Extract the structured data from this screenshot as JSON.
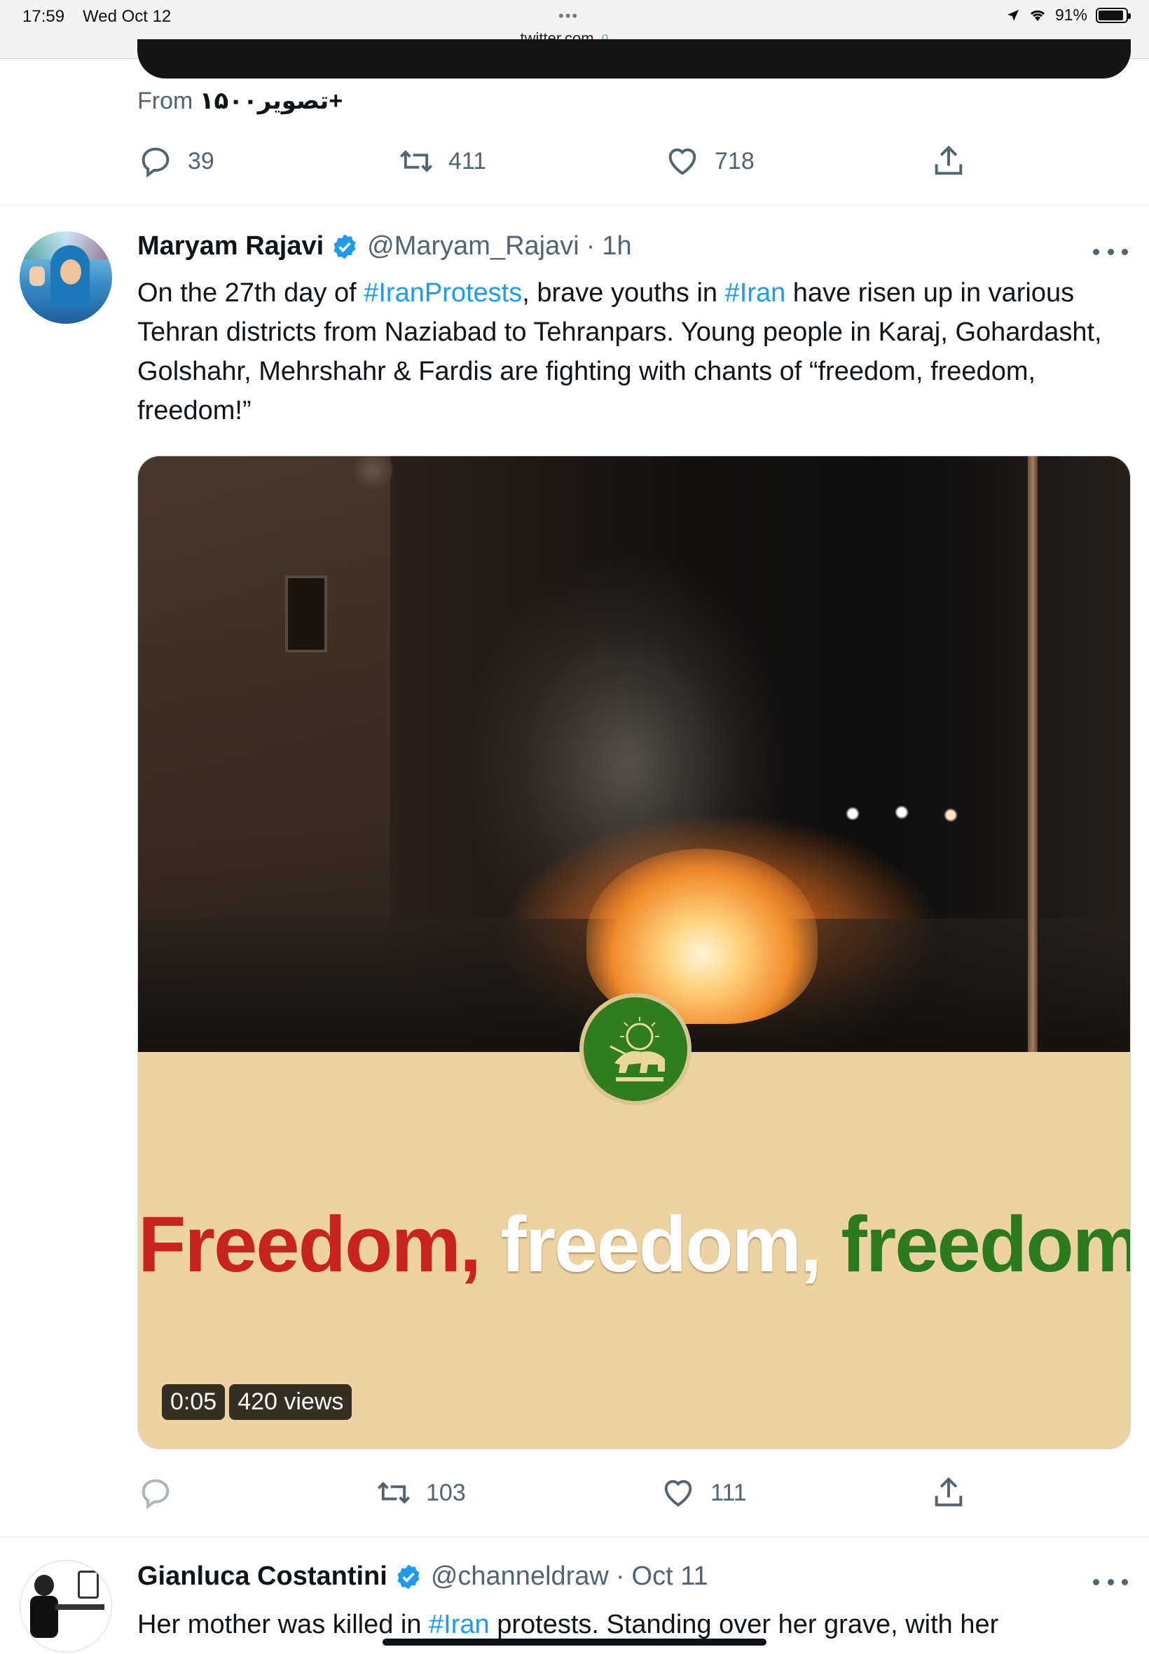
{
  "status_bar": {
    "time": "17:59",
    "date": "Wed Oct 12",
    "url": "twitter.com",
    "battery": "91%"
  },
  "prev_tweet": {
    "from_prefix": "From",
    "from_source": "تصویر۱۵۰۰+",
    "replies": "39",
    "retweets": "411",
    "likes": "718"
  },
  "tweet1": {
    "name": "Maryam Rajavi",
    "handle": "@Maryam_Rajavi",
    "separator": "·",
    "time": "1h",
    "text_1": "On the 27th day of ",
    "tag_1": "#IranProtests",
    "text_2": ", brave youths in ",
    "tag_2": "#Iran",
    "text_3": " have risen up in various Tehran districts from Naziabad to Tehranpars. Young people in Karaj, Gohardasht, Golshahr, Mehrshahr & Fardis  are fighting with chants of “freedom, freedom, freedom!”",
    "video": {
      "caption_word_1": "Freedom,",
      "caption_word_2": "freedom,",
      "caption_word_3": "freedom",
      "duration": "0:05",
      "views": "420 views"
    },
    "retweets": "103",
    "likes": "111"
  },
  "tweet2": {
    "name": "Gianluca Costantini",
    "handle": "@channeldraw",
    "separator": "·",
    "time": "Oct 11",
    "text_1": "Her mother was killed in ",
    "tag_1": "#Iran",
    "text_2": " protests. Standing over her grave, with her"
  },
  "colors": {
    "accent": "#1d9bf0",
    "muted": "#536471",
    "caption_red": "#c8231f",
    "caption_green": "#2b7a1d",
    "caption_bg": "#ecd3a1"
  }
}
